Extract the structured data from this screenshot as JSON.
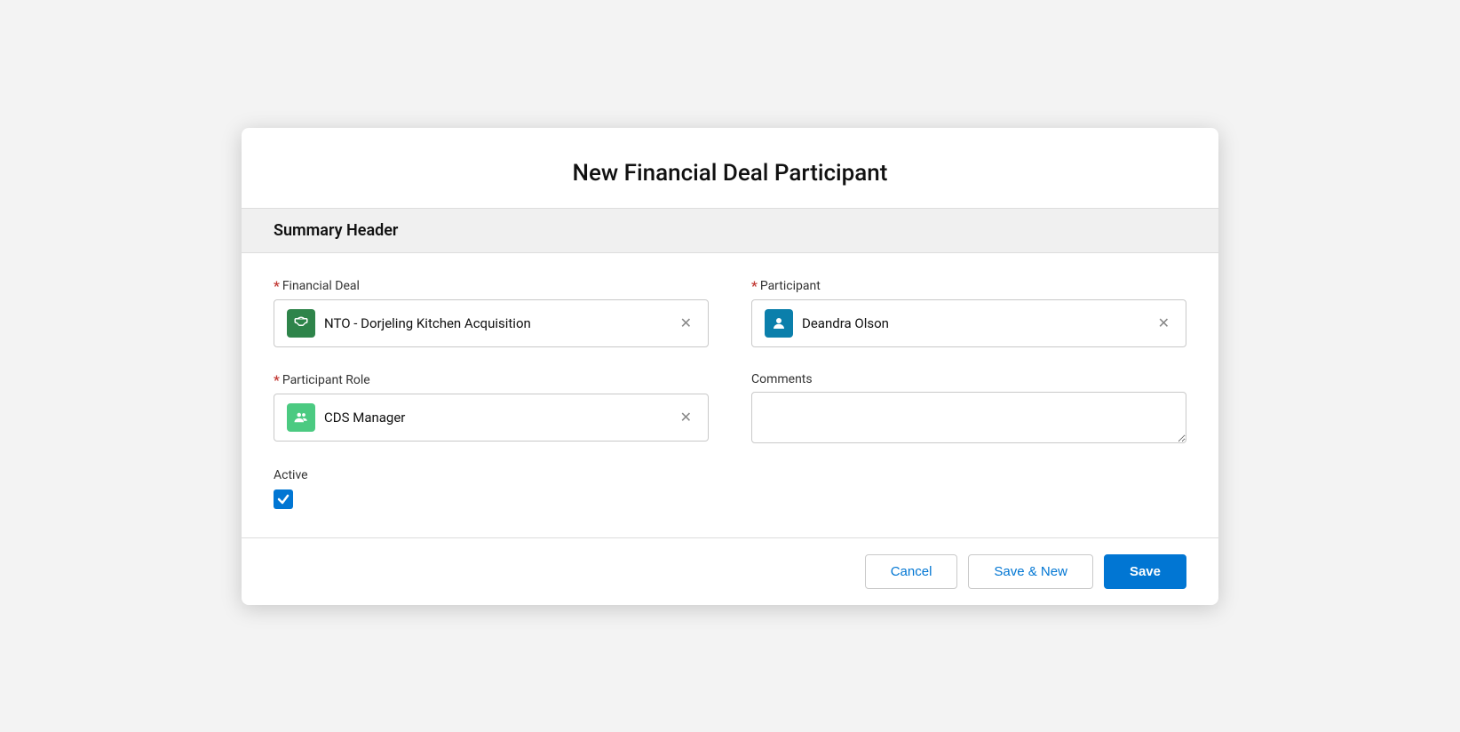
{
  "modal": {
    "title": "New Financial Deal Participant",
    "section_header": "Summary Header"
  },
  "form": {
    "financial_deal": {
      "label": "Financial Deal",
      "required": true,
      "value": "NTO - Dorjeling Kitchen Acquisition",
      "icon": "handshake-icon",
      "icon_color": "green"
    },
    "participant": {
      "label": "Participant",
      "required": true,
      "value": "Deandra Olson",
      "icon": "person-icon",
      "icon_color": "teal"
    },
    "participant_role": {
      "label": "Participant Role",
      "required": true,
      "value": "CDS Manager",
      "icon": "role-icon",
      "icon_color": "light-green"
    },
    "comments": {
      "label": "Comments",
      "required": false,
      "value": "",
      "placeholder": ""
    },
    "active": {
      "label": "Active",
      "checked": true
    }
  },
  "footer": {
    "cancel_label": "Cancel",
    "save_new_label": "Save & New",
    "save_label": "Save"
  }
}
